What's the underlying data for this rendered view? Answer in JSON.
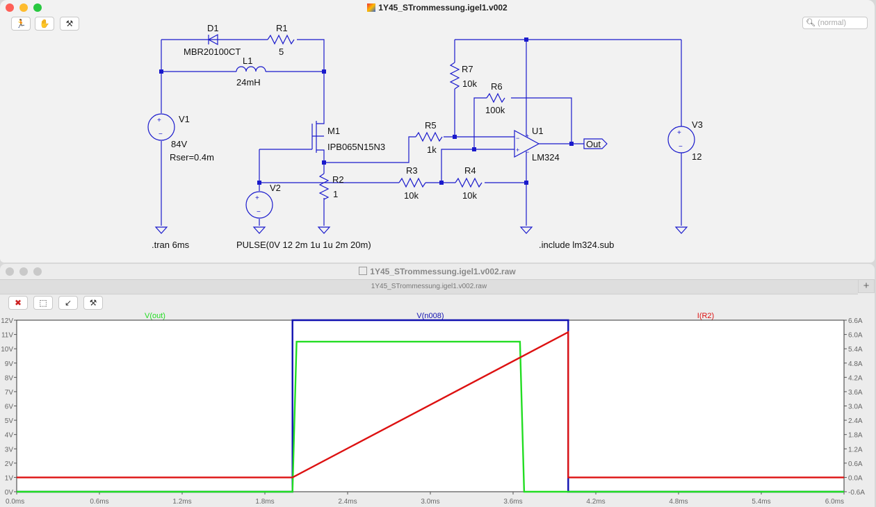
{
  "schematic_window": {
    "title": "1Y45_STrommessung.igel1.v002",
    "search_placeholder": "(normal)",
    "components": {
      "d1_name": "D1",
      "d1_value": "MBR20100CT",
      "r1_name": "R1",
      "r1_value": "5",
      "l1_name": "L1",
      "l1_value": "24mH",
      "v1_name": "V1",
      "v1_value": "84V",
      "v1_rser": "Rser=0.4m",
      "m1_name": "M1",
      "m1_value": "IPB065N15N3",
      "r2_name": "R2",
      "r2_value": "1",
      "v2_name": "V2",
      "v2_value": "PULSE(0V 12 2m 1u 1u 2m 20m)",
      "r7_name": "R7",
      "r7_value": "10k",
      "r6_name": "R6",
      "r6_value": "100k",
      "r5_name": "R5",
      "r5_value": "1k",
      "r3_name": "R3",
      "r3_value": "10k",
      "r4_name": "R4",
      "r4_value": "10k",
      "u1_name": "U1",
      "u1_value": "LM324",
      "v3_name": "V3",
      "v3_value": "12",
      "out_label": "Out"
    },
    "directives": {
      "tran": ".tran 6ms",
      "include": ".include lm324.sub"
    }
  },
  "waveform_window": {
    "title": "1Y45_STrommessung.igel1.v002.raw",
    "subtitle": "1Y45_STrommessung.igel1.v002.raw"
  },
  "chart_data": {
    "type": "line",
    "x_ticks": [
      "0.0ms",
      "0.6ms",
      "1.2ms",
      "1.8ms",
      "2.4ms",
      "3.0ms",
      "3.6ms",
      "4.2ms",
      "4.8ms",
      "5.4ms",
      "6.0ms"
    ],
    "y_ticks_left": [
      "12V",
      "11V",
      "10V",
      "9V",
      "8V",
      "7V",
      "6V",
      "5V",
      "4V",
      "3V",
      "2V",
      "1V",
      "0V"
    ],
    "y_ticks_right": [
      "6.6A",
      "6.0A",
      "5.4A",
      "4.8A",
      "4.2A",
      "3.6A",
      "3.0A",
      "2.4A",
      "1.8A",
      "1.2A",
      "0.6A",
      "0.0A",
      "-0.6A"
    ],
    "xlim": [
      0,
      6.0
    ],
    "ylim_left": [
      0,
      12
    ],
    "ylim_right": [
      -0.6,
      6.6
    ],
    "series": [
      {
        "name": "V(out)",
        "color": "#22dd22",
        "axis": "left",
        "x": [
          0,
          2.0,
          2.03,
          3.65,
          3.68,
          6.0
        ],
        "y": [
          0,
          0,
          10.5,
          10.5,
          0,
          0
        ]
      },
      {
        "name": "V(n008)",
        "color": "#1010b0",
        "axis": "left",
        "x": [
          0,
          2.0,
          2.0,
          4.0,
          4.0,
          6.0
        ],
        "y": [
          0,
          0,
          12,
          12,
          0,
          0
        ]
      },
      {
        "name": "I(R2)",
        "color": "#dd1111",
        "axis": "right",
        "x": [
          0,
          2.0,
          4.0,
          4.0,
          6.0
        ],
        "y": [
          0,
          0,
          6.1,
          0,
          0
        ]
      }
    ]
  }
}
